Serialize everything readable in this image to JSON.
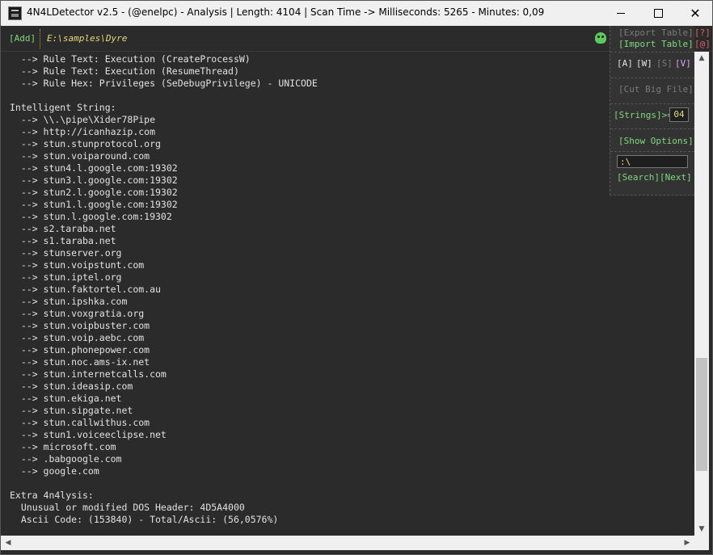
{
  "window": {
    "title": "4N4LDetector v2.5 - (@enelpc) - Analysis | Length: 4104 | Scan Time -> Milliseconds: 5265 - Minutes: 0,09",
    "min_glyph": "",
    "max_glyph": "",
    "close_glyph": "✕"
  },
  "pathbar": {
    "add_label": "[Add]",
    "path": "E:\\samples\\Dyre"
  },
  "panel": {
    "export_label": "[Export Table]",
    "help_label": "[?]",
    "import_label": "[Import Table]",
    "at_label": "[@]",
    "mode_a": "[A]",
    "mode_w": "[W]",
    "mode_s": "[S]",
    "mode_v": "[V]",
    "cut_label": "[Cut Big File]",
    "strings_label": "[Strings]>=",
    "strings_value": "04",
    "options_label": "[Show Options]",
    "search_value": ":\\",
    "search_label": "[Search]",
    "next_label": "[Next]"
  },
  "content": {
    "lines": [
      "  --> Rule Text: Execution (CreateProcessW)",
      "  --> Rule Text: Execution (ResumeThread)",
      "  --> Rule Hex: Privileges (SeDebugPrivilege) - UNICODE",
      "",
      "Intelligent String:",
      "  --> \\\\.\\pipe\\Xider78Pipe",
      "  --> http://icanhazip.com",
      "  --> stun.stunprotocol.org",
      "  --> stun.voiparound.com",
      "  --> stun4.l.google.com:19302",
      "  --> stun3.l.google.com:19302",
      "  --> stun2.l.google.com:19302",
      "  --> stun1.l.google.com:19302",
      "  --> stun.l.google.com:19302",
      "  --> s2.taraba.net",
      "  --> s1.taraba.net",
      "  --> stunserver.org",
      "  --> stun.voipstunt.com",
      "  --> stun.iptel.org",
      "  --> stun.faktortel.com.au",
      "  --> stun.ipshka.com",
      "  --> stun.voxgratia.org",
      "  --> stun.voipbuster.com",
      "  --> stun.voip.aebc.com",
      "  --> stun.phonepower.com",
      "  --> stun.noc.ams-ix.net",
      "  --> stun.internetcalls.com",
      "  --> stun.ideasip.com",
      "  --> stun.ekiga.net",
      "  --> stun.sipgate.net",
      "  --> stun.callwithus.com",
      "  --> stun1.voiceeclipse.net",
      "  --> microsoft.com",
      "  --> .babgoogle.com",
      "  --> google.com",
      "",
      "Extra 4n4lysis:",
      "  Unusual or modified DOS Header: 4D5A4000",
      "  Ascii Code: (153840) - Total/Ascii: (56,0576%)"
    ]
  },
  "scrollbars": {
    "up_glyph": "▲",
    "down_glyph": "▼",
    "left_glyph": "◀",
    "right_glyph": "▶",
    "vertical_position": 0.85
  }
}
